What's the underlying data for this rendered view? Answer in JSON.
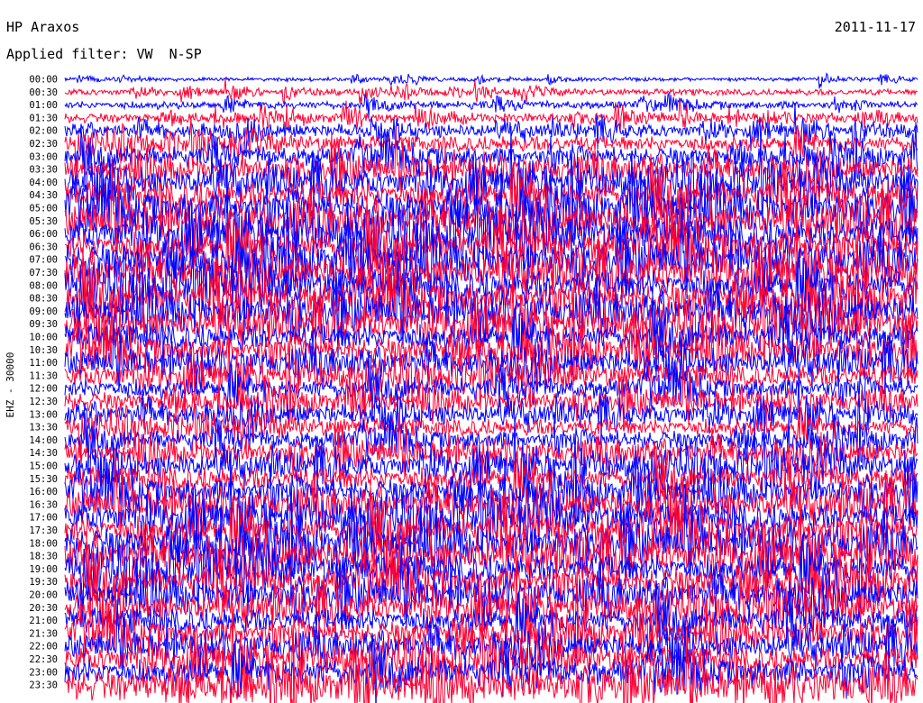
{
  "header": {
    "station": "HP Araxos",
    "date": "2011-11-17",
    "filter": "Applied filter: VW  N-SP"
  },
  "chart_data": {
    "type": "line",
    "title": "HP Araxos",
    "date": "2011-11-17",
    "filter": "Applied filter: VW  N-SP",
    "ylabel": "EHZ - 30000",
    "row_labels": [
      "00:00",
      "00:30",
      "01:00",
      "01:30",
      "02:00",
      "02:30",
      "03:00",
      "03:30",
      "04:00",
      "04:30",
      "05:00",
      "05:30",
      "06:00",
      "06:30",
      "07:00",
      "07:30",
      "08:00",
      "08:30",
      "09:00",
      "09:30",
      "10:00",
      "10:30",
      "11:00",
      "11:30",
      "12:00",
      "12:30",
      "13:00",
      "13:30",
      "14:00",
      "14:30",
      "15:00",
      "15:30",
      "16:00",
      "16:30",
      "17:00",
      "17:30",
      "18:00",
      "18:30",
      "19:00",
      "19:30",
      "20:00",
      "20:30",
      "21:00",
      "21:30",
      "22:00",
      "22:30",
      "23:00",
      "23:30"
    ],
    "series_colors": [
      "#0000ff",
      "#ff0033"
    ],
    "row_amplitude": [
      0.25,
      0.4,
      0.5,
      0.6,
      0.8,
      1.0,
      1.2,
      1.4,
      1.6,
      1.8,
      2.0,
      2.0,
      2.0,
      2.0,
      2.0,
      2.0,
      2.0,
      2.0,
      1.9,
      1.8,
      1.7,
      1.6,
      1.5,
      1.4,
      1.3,
      1.2,
      1.2,
      1.1,
      1.2,
      1.3,
      1.4,
      1.5,
      1.6,
      1.7,
      1.8,
      1.9,
      1.9,
      2.0,
      1.9,
      1.8,
      1.7,
      1.6,
      1.6,
      1.5,
      1.5,
      1.6,
      1.7,
      1.9
    ]
  }
}
